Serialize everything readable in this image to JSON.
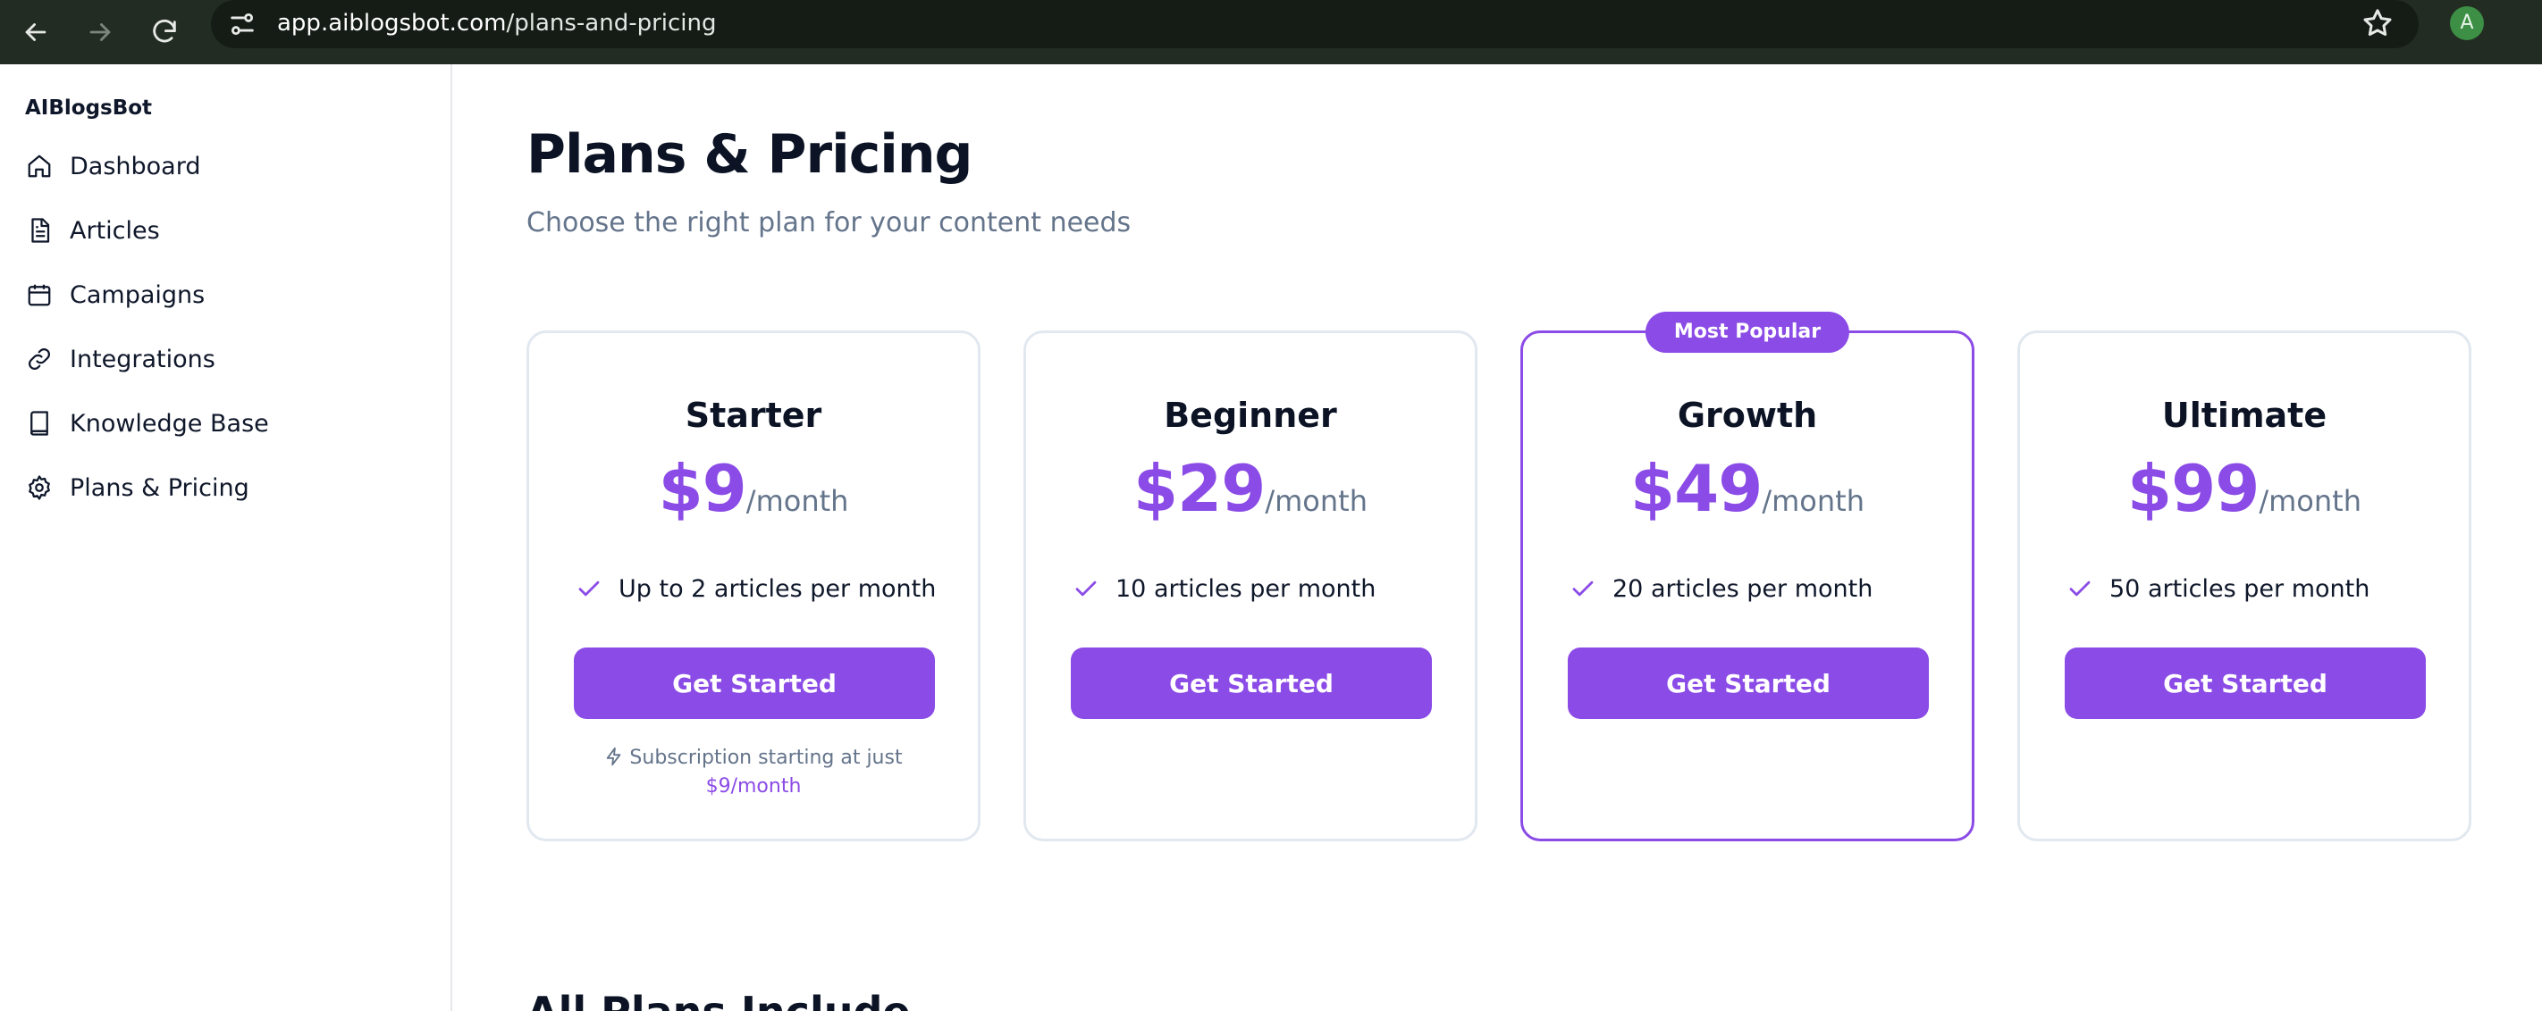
{
  "browser": {
    "url_host": "app.aiblogsbot.com",
    "url_path": "/plans-and-pricing",
    "profile_initial": "A",
    "icons": [
      "back-icon",
      "forward-icon",
      "reload-icon",
      "site-info-icon",
      "star-icon"
    ]
  },
  "sidebar": {
    "brand": "AIBlogsBot",
    "items": [
      {
        "label": "Dashboard",
        "icon": "home-icon"
      },
      {
        "label": "Articles",
        "icon": "file-text-icon"
      },
      {
        "label": "Campaigns",
        "icon": "calendar-icon"
      },
      {
        "label": "Integrations",
        "icon": "link-icon"
      },
      {
        "label": "Knowledge Base",
        "icon": "book-icon"
      },
      {
        "label": "Plans & Pricing",
        "icon": "gear-icon"
      }
    ]
  },
  "main": {
    "title": "Plans & Pricing",
    "subtitle": "Choose the right plan for your content needs",
    "plans": [
      {
        "name": "Starter",
        "price": "$9",
        "period": "/month",
        "feature": "Up to 2 articles per month",
        "cta": "Get Started",
        "note_text": "Subscription starting at just",
        "note_price": "$9/month"
      },
      {
        "name": "Beginner",
        "price": "$29",
        "period": "/month",
        "feature": "10 articles per month",
        "cta": "Get Started"
      },
      {
        "name": "Growth",
        "price": "$49",
        "period": "/month",
        "feature": "20 articles per month",
        "cta": "Get Started",
        "badge": "Most Popular"
      },
      {
        "name": "Ultimate",
        "price": "$99",
        "period": "/month",
        "feature": "50 articles per month",
        "cta": "Get Started"
      }
    ],
    "section_heading": "All Plans Include"
  },
  "colors": {
    "accent": "#8b4be6",
    "chrome": "#232c22",
    "muted_text": "#64748b",
    "card_border": "#e2e8f0"
  }
}
